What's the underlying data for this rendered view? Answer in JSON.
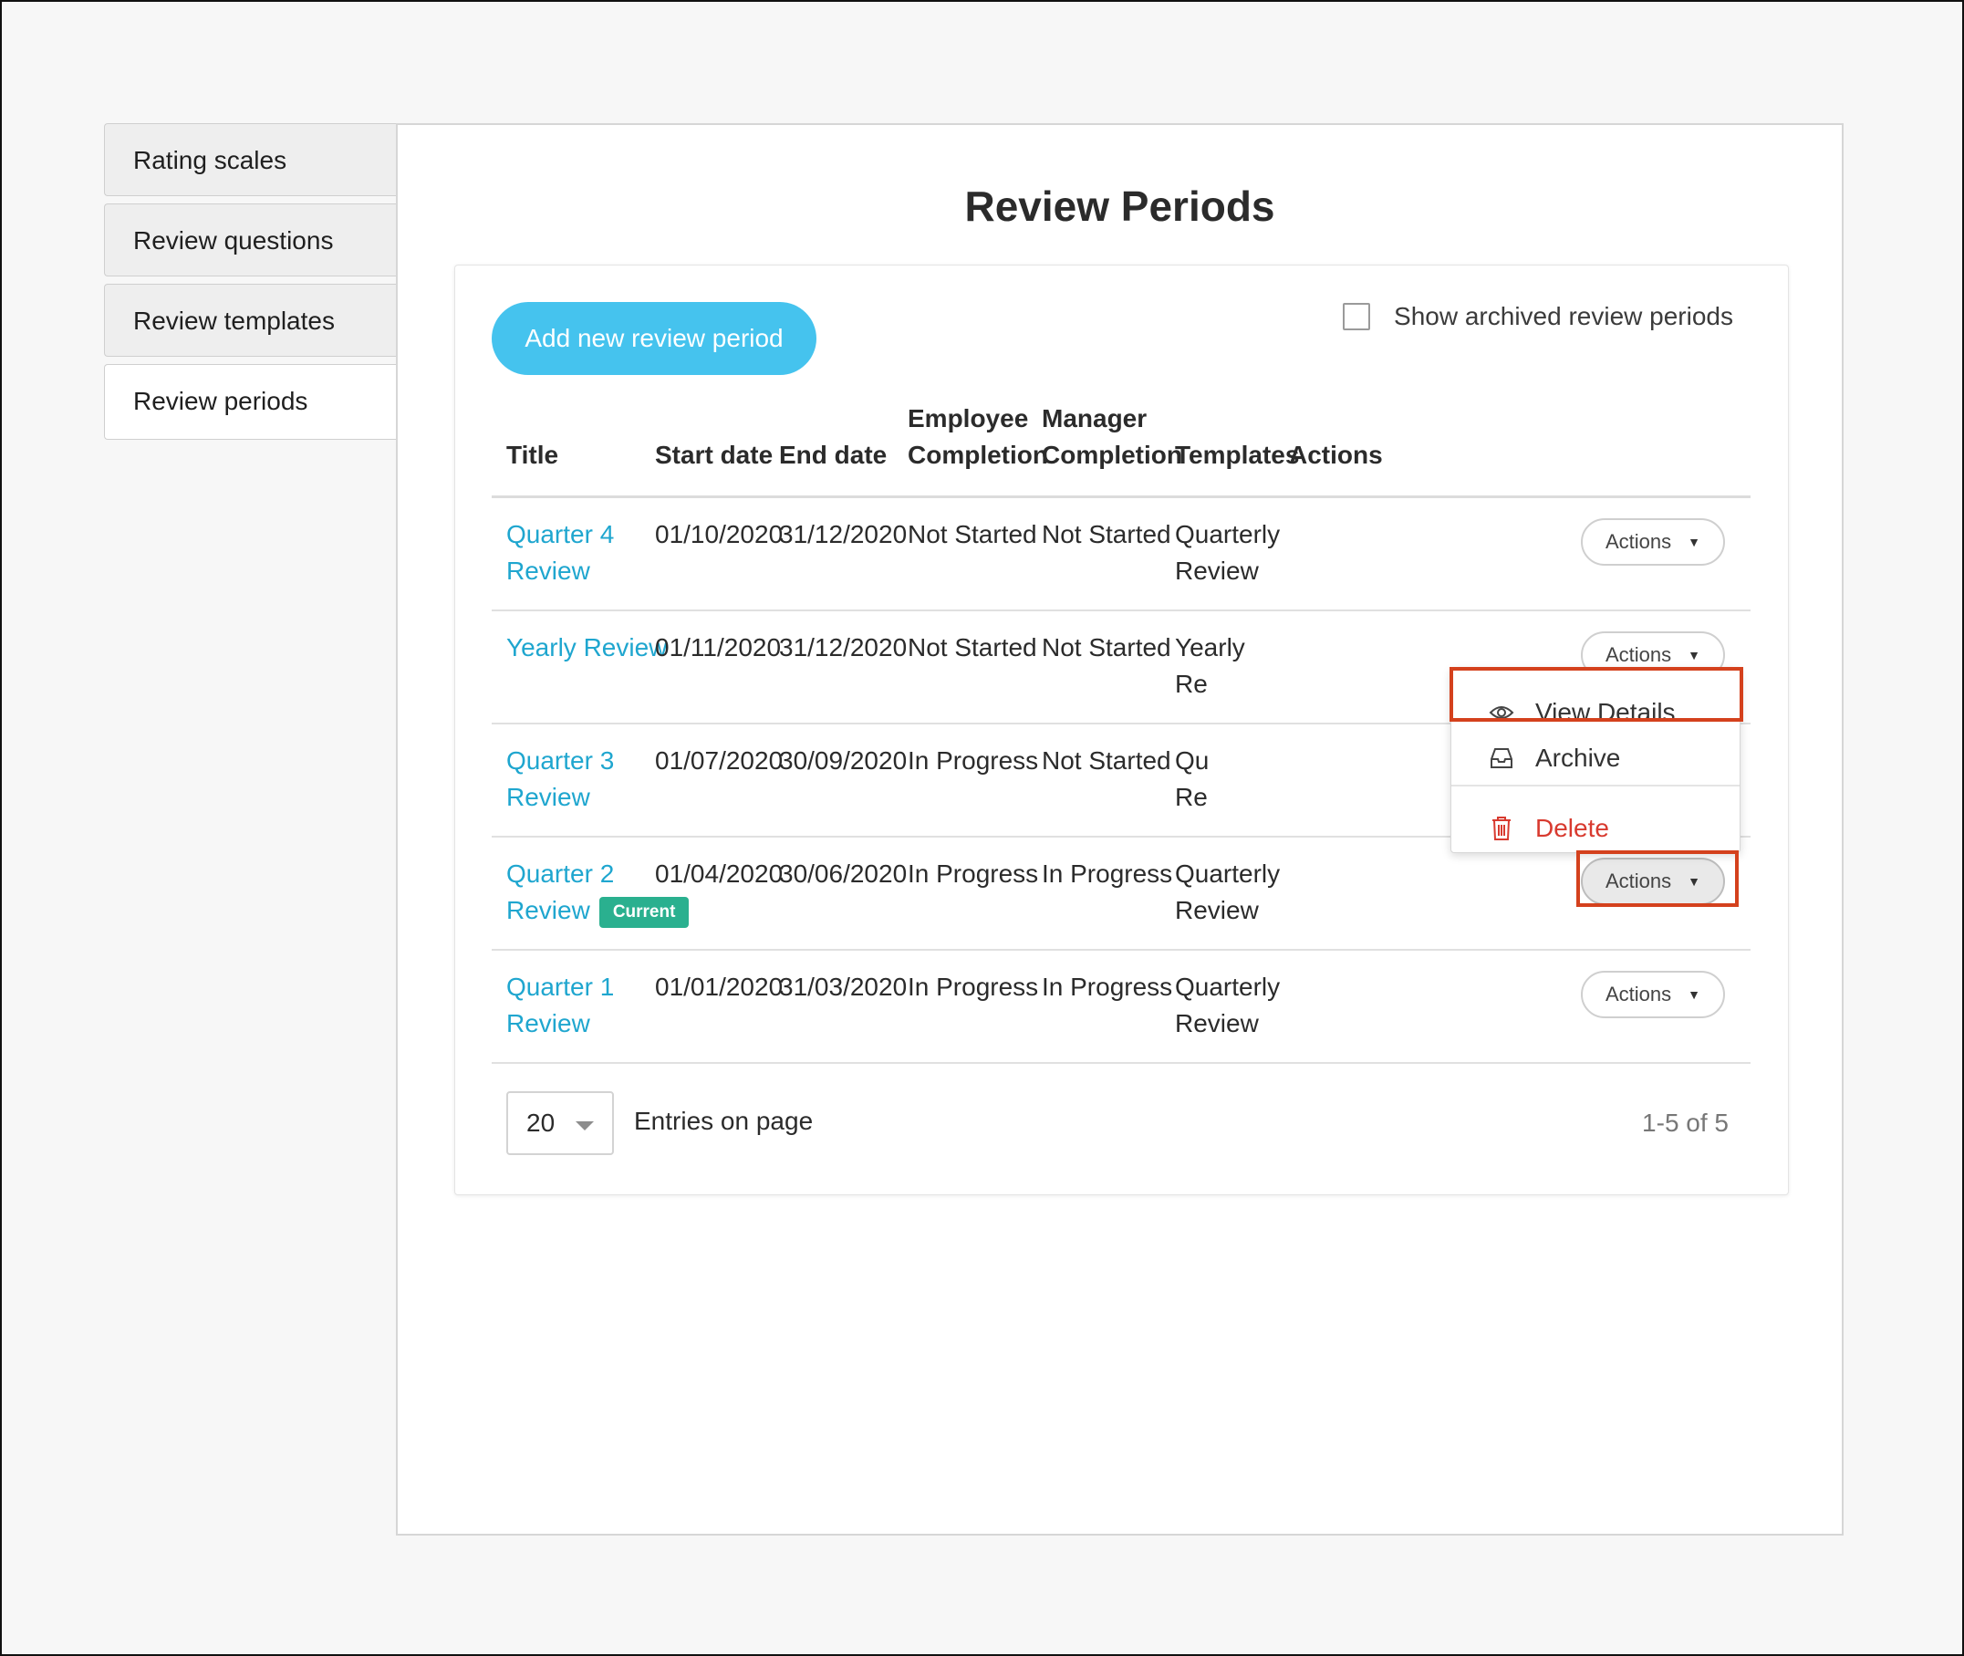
{
  "sidebar": {
    "items": [
      {
        "label": "Rating scales"
      },
      {
        "label": "Review questions"
      },
      {
        "label": "Review templates"
      },
      {
        "label": "Review periods"
      }
    ]
  },
  "page": {
    "title": "Review Periods",
    "add_button": "Add new review period",
    "show_archived_label": "Show archived review periods",
    "show_archived_checked": false
  },
  "table": {
    "headers": {
      "title": "Title",
      "start": "Start date",
      "end": "End date",
      "employee_line1": "Employee",
      "employee_line2": "Completion",
      "manager_line1": "Manager",
      "manager_line2": "Completion",
      "templates": "Templates",
      "actions": "Actions"
    },
    "rows": [
      {
        "title_line1": "Quarter 4",
        "title_line2": "Review",
        "start": "01/10/2020",
        "end": "31/12/2020",
        "employee": "Not Started",
        "manager": "Not Started",
        "template_line1": "Quarterly",
        "template_line2": "Review",
        "actions": "Actions"
      },
      {
        "title_line1": "Yearly Review",
        "title_line2": "",
        "start": "01/11/2020",
        "end": "31/12/2020",
        "employee": "Not Started",
        "manager": "Not Started",
        "template_line1": "Yearly",
        "template_line2": "Re",
        "actions": "Actions"
      },
      {
        "title_line1": "Quarter 3",
        "title_line2": "Review",
        "start": "01/07/2020",
        "end": "30/09/2020",
        "employee": "In Progress",
        "manager": "Not Started",
        "template_line1": "Qu",
        "template_line2": "Re",
        "actions": ""
      },
      {
        "title_line1": "Quarter 2",
        "title_line2": "Review",
        "badge": "Current",
        "start": "01/04/2020",
        "end": "30/06/2020",
        "employee": "In Progress",
        "manager": "In Progress",
        "template_line1": "Quarterly",
        "template_line2": "Review",
        "actions": "Actions"
      },
      {
        "title_line1": "Quarter 1",
        "title_line2": "Review",
        "start": "01/01/2020",
        "end": "31/03/2020",
        "employee": "In Progress",
        "manager": "In Progress",
        "template_line1": "Quarterly",
        "template_line2": "Review",
        "actions": "Actions"
      }
    ]
  },
  "footer": {
    "entries_value": "20",
    "entries_label": "Entries on page",
    "pagination": "1-5 of 5"
  },
  "dropdown": {
    "items": [
      {
        "label": "View Details",
        "icon": "eye-icon"
      },
      {
        "label": "Archive",
        "icon": "archive-icon"
      },
      {
        "label": "Delete",
        "icon": "trash-icon"
      }
    ]
  },
  "colors": {
    "accent": "#45c3ee",
    "link": "#1fa6cf",
    "badge": "#2ab08f",
    "danger": "#d83a2f",
    "highlight": "#d4411d"
  }
}
